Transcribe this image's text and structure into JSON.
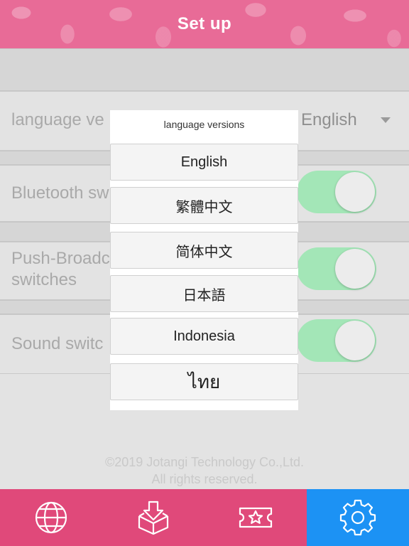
{
  "header": {
    "title": "Set up"
  },
  "settings": {
    "language_label": "language ve",
    "language_value": "English",
    "bluetooth_label": "Bluetooth sw",
    "push_label_line1": "Push-Broadc",
    "push_label_line2": "switches",
    "sound_label": "Sound switc"
  },
  "footer": {
    "copyright": "©2019 Jotangi Technology Co.,Ltd.",
    "rights": "All rights reserved."
  },
  "popup": {
    "title": "language versions",
    "options": [
      "English",
      "繁體中文",
      "简体中文",
      "日本語",
      "Indonesia",
      "ไทย"
    ]
  },
  "tabbar": {
    "active_index": 3,
    "icons": [
      "globe-icon",
      "download-box-icon",
      "star-ticket-icon",
      "gear-icon"
    ],
    "colors": {
      "bar": "#e0497a",
      "active": "#1c92f4",
      "toggle_on": "#a3e6b7"
    }
  }
}
